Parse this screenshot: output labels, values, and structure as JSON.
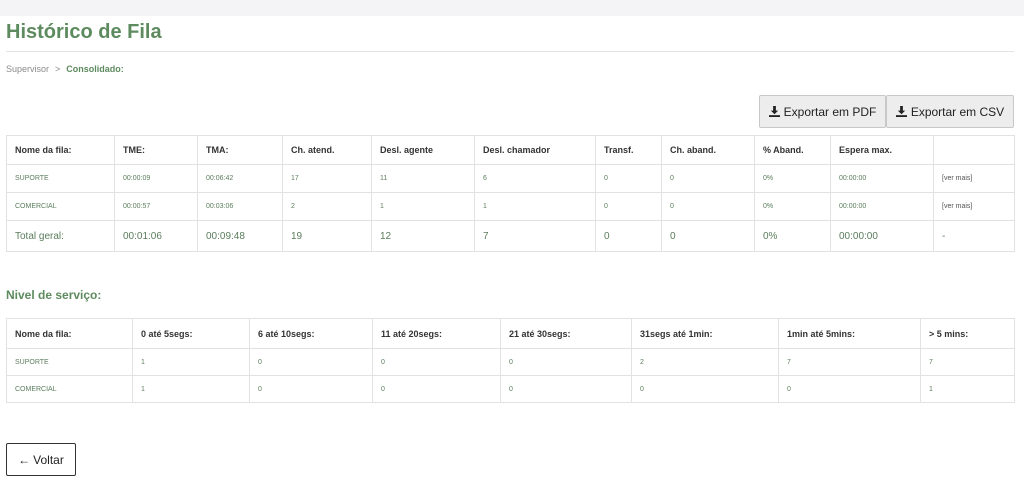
{
  "page": {
    "title": "Histórico de Fila"
  },
  "breadcrumb": {
    "parent": "Supervisor",
    "separator": ">",
    "current": "Consolidado:"
  },
  "actions": {
    "export_pdf": "Exportar em PDF",
    "export_csv": "Exportar em CSV",
    "back": "Voltar"
  },
  "main_table": {
    "headers": [
      "Nome da fila:",
      "TME:",
      "TMA:",
      "Ch. atend.",
      "Desl. agente",
      "Desl. chamador",
      "Transf.",
      "Ch. aband.",
      "% Aband.",
      "Espera max.",
      ""
    ],
    "rows": [
      [
        "SUPORTE",
        "00:00:09",
        "00:06:42",
        "17",
        "11",
        "6",
        "0",
        "0",
        "0%",
        "00:00:00",
        "[ver mais]"
      ],
      [
        "COMERCIAL",
        "00:00:57",
        "00:03:06",
        "2",
        "1",
        "1",
        "0",
        "0",
        "0%",
        "00:00:00",
        "[ver mais]"
      ]
    ],
    "total": [
      "Total geral:",
      "00:01:06",
      "00:09:48",
      "19",
      "12",
      "7",
      "0",
      "0",
      "0%",
      "00:00:00",
      "-"
    ]
  },
  "service_level": {
    "title": "Nivel de serviço:",
    "headers": [
      "Nome da fila:",
      "0 até 5segs:",
      "6 até 10segs:",
      "11 até 20segs:",
      "21 até 30segs:",
      "31segs até 1min:",
      "1min até 5mins:",
      "> 5 mins:"
    ],
    "rows": [
      [
        "SUPORTE",
        "1",
        "0",
        "0",
        "0",
        "2",
        "7",
        "7"
      ],
      [
        "COMERCIAL",
        "1",
        "0",
        "0",
        "0",
        "0",
        "0",
        "1"
      ]
    ]
  },
  "icons": {
    "download": "download-icon",
    "back": "arrow-left-icon"
  },
  "colors": {
    "accent": "#5d8a5e",
    "button_bg": "#ededed",
    "border": "#e2e2e2"
  }
}
